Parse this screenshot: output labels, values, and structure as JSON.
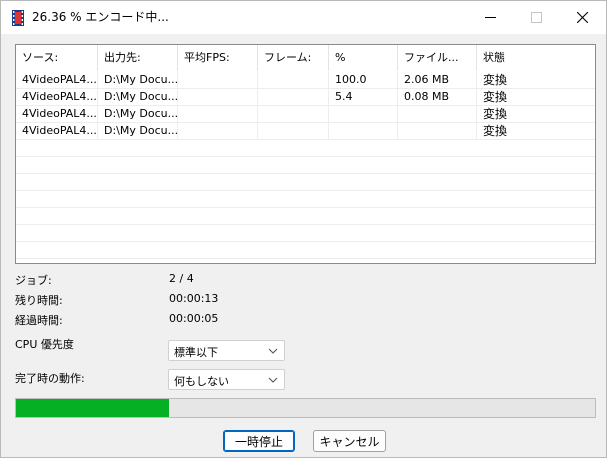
{
  "window": {
    "title": "26.36 % エンコード中..."
  },
  "list": {
    "columns": [
      "ソース:",
      "出力先:",
      "平均FPS:",
      "フレーム:",
      "%",
      "ファイル...",
      "状態"
    ],
    "rows": [
      [
        "4VideoPAL4...",
        "D:\\My Docu...",
        "",
        "",
        "100.0",
        "2.06 MB",
        "変換"
      ],
      [
        "4VideoPAL4...",
        "D:\\My Docu...",
        "",
        "",
        "5.4",
        "0.08 MB",
        "変換"
      ],
      [
        "4VideoPAL4...",
        "D:\\My Docu...",
        "",
        "",
        "",
        "",
        "変換"
      ],
      [
        "4VideoPAL4...",
        "D:\\My Docu...",
        "",
        "",
        "",
        "",
        "変換"
      ]
    ]
  },
  "info": {
    "job_label": "ジョブ:",
    "job_value": "2 / 4",
    "remaining_label": "残り時間:",
    "remaining_value": "00:00:13",
    "elapsed_label": "経過時間:",
    "elapsed_value": "00:00:05"
  },
  "settings": {
    "cpu_priority_label": "CPU 優先度",
    "cpu_priority_value": "標準以下",
    "on_complete_label": "完了時の動作:",
    "on_complete_value": "何もしない"
  },
  "progress": {
    "fraction": 0.2636,
    "color": "#06b025"
  },
  "buttons": {
    "pause_label": "一時停止",
    "cancel_label": "キャンセル"
  },
  "icons": {
    "app": "film-icon",
    "minimize": "minimize-icon",
    "maximize": "maximize-icon",
    "close": "close-icon",
    "dropdown": "chevron-down-icon"
  }
}
